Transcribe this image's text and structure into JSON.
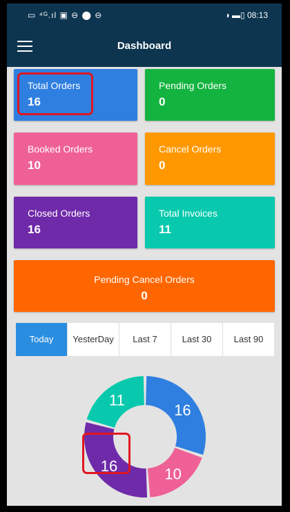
{
  "status_bar": {
    "left_text": "▭ ⁴ᴳ.ıl ▣ ⊖ ⬤ ⊖",
    "right_text": "◑ ▬▯ 08:13"
  },
  "app_bar": {
    "title": "Dashboard",
    "menu_icon": "hamburger-menu-icon"
  },
  "cards": [
    {
      "label": "Total Orders",
      "value": "16",
      "color": "#2f7fe0"
    },
    {
      "label": "Pending Orders",
      "value": "0",
      "color": "#13b33f"
    },
    {
      "label": "Booked Orders",
      "value": "10",
      "color": "#ef6196"
    },
    {
      "label": "Cancel Orders",
      "value": "0",
      "color": "#ff9800"
    },
    {
      "label": "Closed Orders",
      "value": "16",
      "color": "#6f2aa9"
    },
    {
      "label": "Total Invoices",
      "value": "11",
      "color": "#08c9ad"
    },
    {
      "label": "Pending Cancel Orders",
      "value": "0",
      "color": "#ff6600"
    }
  ],
  "tabs": [
    {
      "label": "Today",
      "active": true
    },
    {
      "label": "YesterDay",
      "active": false
    },
    {
      "label": "Last 7",
      "active": false
    },
    {
      "label": "Last 30",
      "active": false
    },
    {
      "label": "Last 90",
      "active": false
    }
  ],
  "tab_active_color": "#2a8ee0",
  "chart_data": {
    "type": "pie",
    "variant": "donut",
    "slices": [
      {
        "label": "16",
        "value": 16,
        "color": "#2f7fe0"
      },
      {
        "label": "10",
        "value": 10,
        "color": "#ef6196"
      },
      {
        "label": "16",
        "value": 16,
        "color": "#6f2aa9"
      },
      {
        "label": "11",
        "value": 11,
        "color": "#08c9ad"
      }
    ]
  }
}
